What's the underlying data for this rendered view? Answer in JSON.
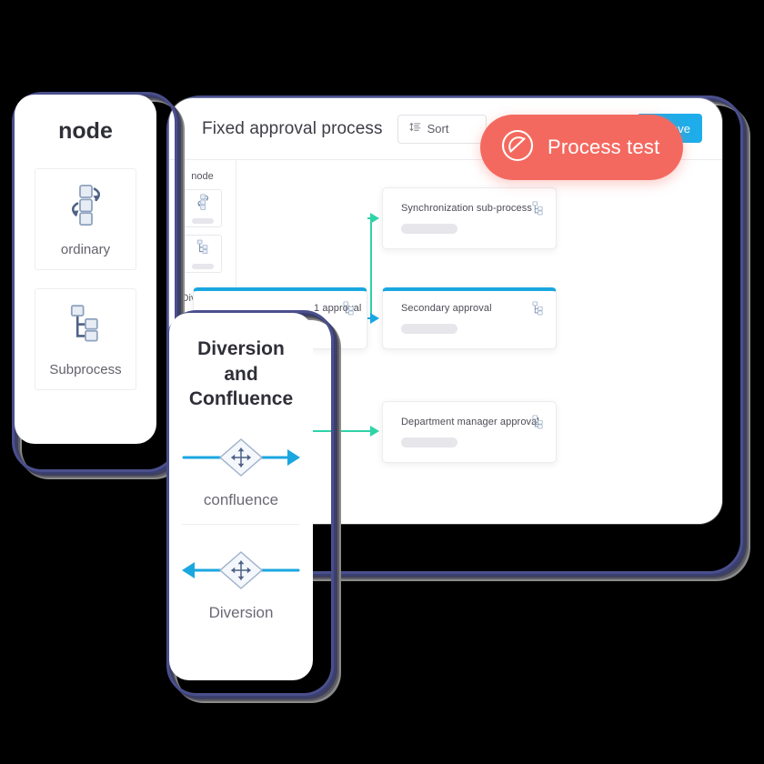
{
  "app": {
    "title": "Fixed approval process"
  },
  "toolbar": {
    "sort_label": "Sort",
    "sort_icon": "sort-list-icon",
    "save_label": "save",
    "save_icon": "trash-icon",
    "save_color": "#1eadea"
  },
  "process_test": {
    "label": "Process test",
    "icon": "gauge-icon",
    "color": "#f4695f"
  },
  "palette": {
    "group_label": "node",
    "group_label_2": "Diversion",
    "tiles": [
      {
        "icon": "ordinary-node-icon"
      },
      {
        "icon": "subprocess-node-icon"
      }
    ]
  },
  "node_panel": {
    "heading": "node",
    "items": [
      {
        "label": "ordinary",
        "icon": "ordinary-node-icon"
      },
      {
        "label": "Subprocess",
        "icon": "subprocess-node-icon"
      }
    ]
  },
  "diversion_panel": {
    "heading": "Diversion and Confluence",
    "items": [
      {
        "label": "confluence",
        "icon": "confluence-diamond-icon"
      },
      {
        "label": "Diversion",
        "icon": "diversion-diamond-icon"
      }
    ]
  },
  "flow": {
    "cards": [
      {
        "title": "Synchronization sub-process",
        "accent": false,
        "icon": "subprocess-node-icon"
      },
      {
        "title": "Secondary approval",
        "accent": true,
        "icon": "subprocess-node-icon"
      },
      {
        "title": "Department manager approval",
        "accent": false,
        "icon": "subprocess-node-icon"
      },
      {
        "title": "1 approval",
        "accent": true,
        "icon": "subprocess-node-icon"
      }
    ],
    "connector_colors": {
      "green": "#2ed3a7",
      "blue": "#1aa7e0"
    }
  }
}
